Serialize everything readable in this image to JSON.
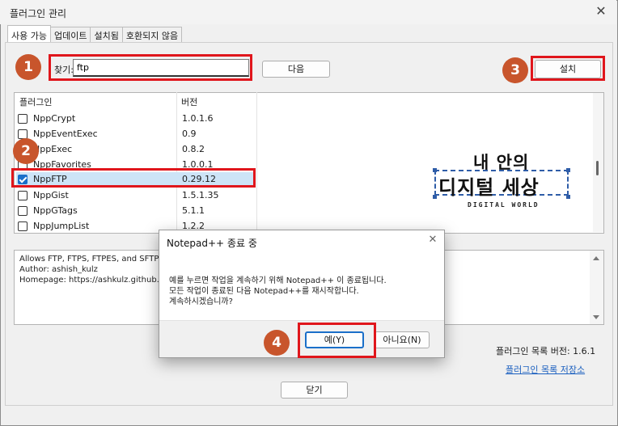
{
  "window": {
    "title": "플러그인 관리",
    "close_glyph": "✕"
  },
  "tabs": [
    "사용 가능",
    "업데이트",
    "설치됨",
    "호환되지 않음"
  ],
  "search": {
    "label": "찾기:",
    "value": "ftp"
  },
  "buttons": {
    "next": "다음",
    "install": "설치",
    "close": "닫기",
    "yes": "예(Y)",
    "no": "아니요(N)"
  },
  "plugin_list": {
    "columns": [
      "플러그인",
      "버전"
    ],
    "rows": [
      {
        "name": "NppCrypt",
        "version": "1.0.1.6",
        "checked": false
      },
      {
        "name": "NppEventExec",
        "version": "0.9",
        "checked": false
      },
      {
        "name": "NppExec",
        "version": "0.8.2",
        "checked": false
      },
      {
        "name": "NppFavorites",
        "version": "1.0.0.1",
        "checked": false
      },
      {
        "name": "NppFTP",
        "version": "0.29.12",
        "checked": true
      },
      {
        "name": "NppGist",
        "version": "1.5.1.35",
        "checked": false
      },
      {
        "name": "NppGTags",
        "version": "5.1.1",
        "checked": false
      },
      {
        "name": "NppJumpList",
        "version": "1.2.2",
        "checked": false
      }
    ]
  },
  "description": {
    "lines": [
      "Allows FTP, FTPS, FTPES, and SFTP",
      "Author: ashish_kulz",
      "Homepage: https://ashkulz.github.io"
    ]
  },
  "footer": {
    "list_version": "플러그인 목록 버전:  1.6.1",
    "save_link": "플러그인 목록 저장소"
  },
  "dialog": {
    "title": "Notepad++ 종료 중",
    "close_glyph": "✕",
    "message_lines": [
      "예를 누르면 작업을 계속하기 위해 Notepad++ 이 종료됩니다.",
      "모든 작업이 종료된 다음 Notepad++를 재시작합니다.",
      "계속하시겠습니까?"
    ]
  },
  "annotations": {
    "badges": [
      "1",
      "2",
      "3",
      "4"
    ],
    "badge_color": "#c8552c",
    "highlight_color": "#e0161c"
  },
  "logo": {
    "top_text": "내 안의",
    "main_text": "디지털 세상",
    "sub_text": "DIGITAL WORLD"
  },
  "colors": {
    "accent": "#1a6fc9",
    "link": "#1a5fbf"
  }
}
